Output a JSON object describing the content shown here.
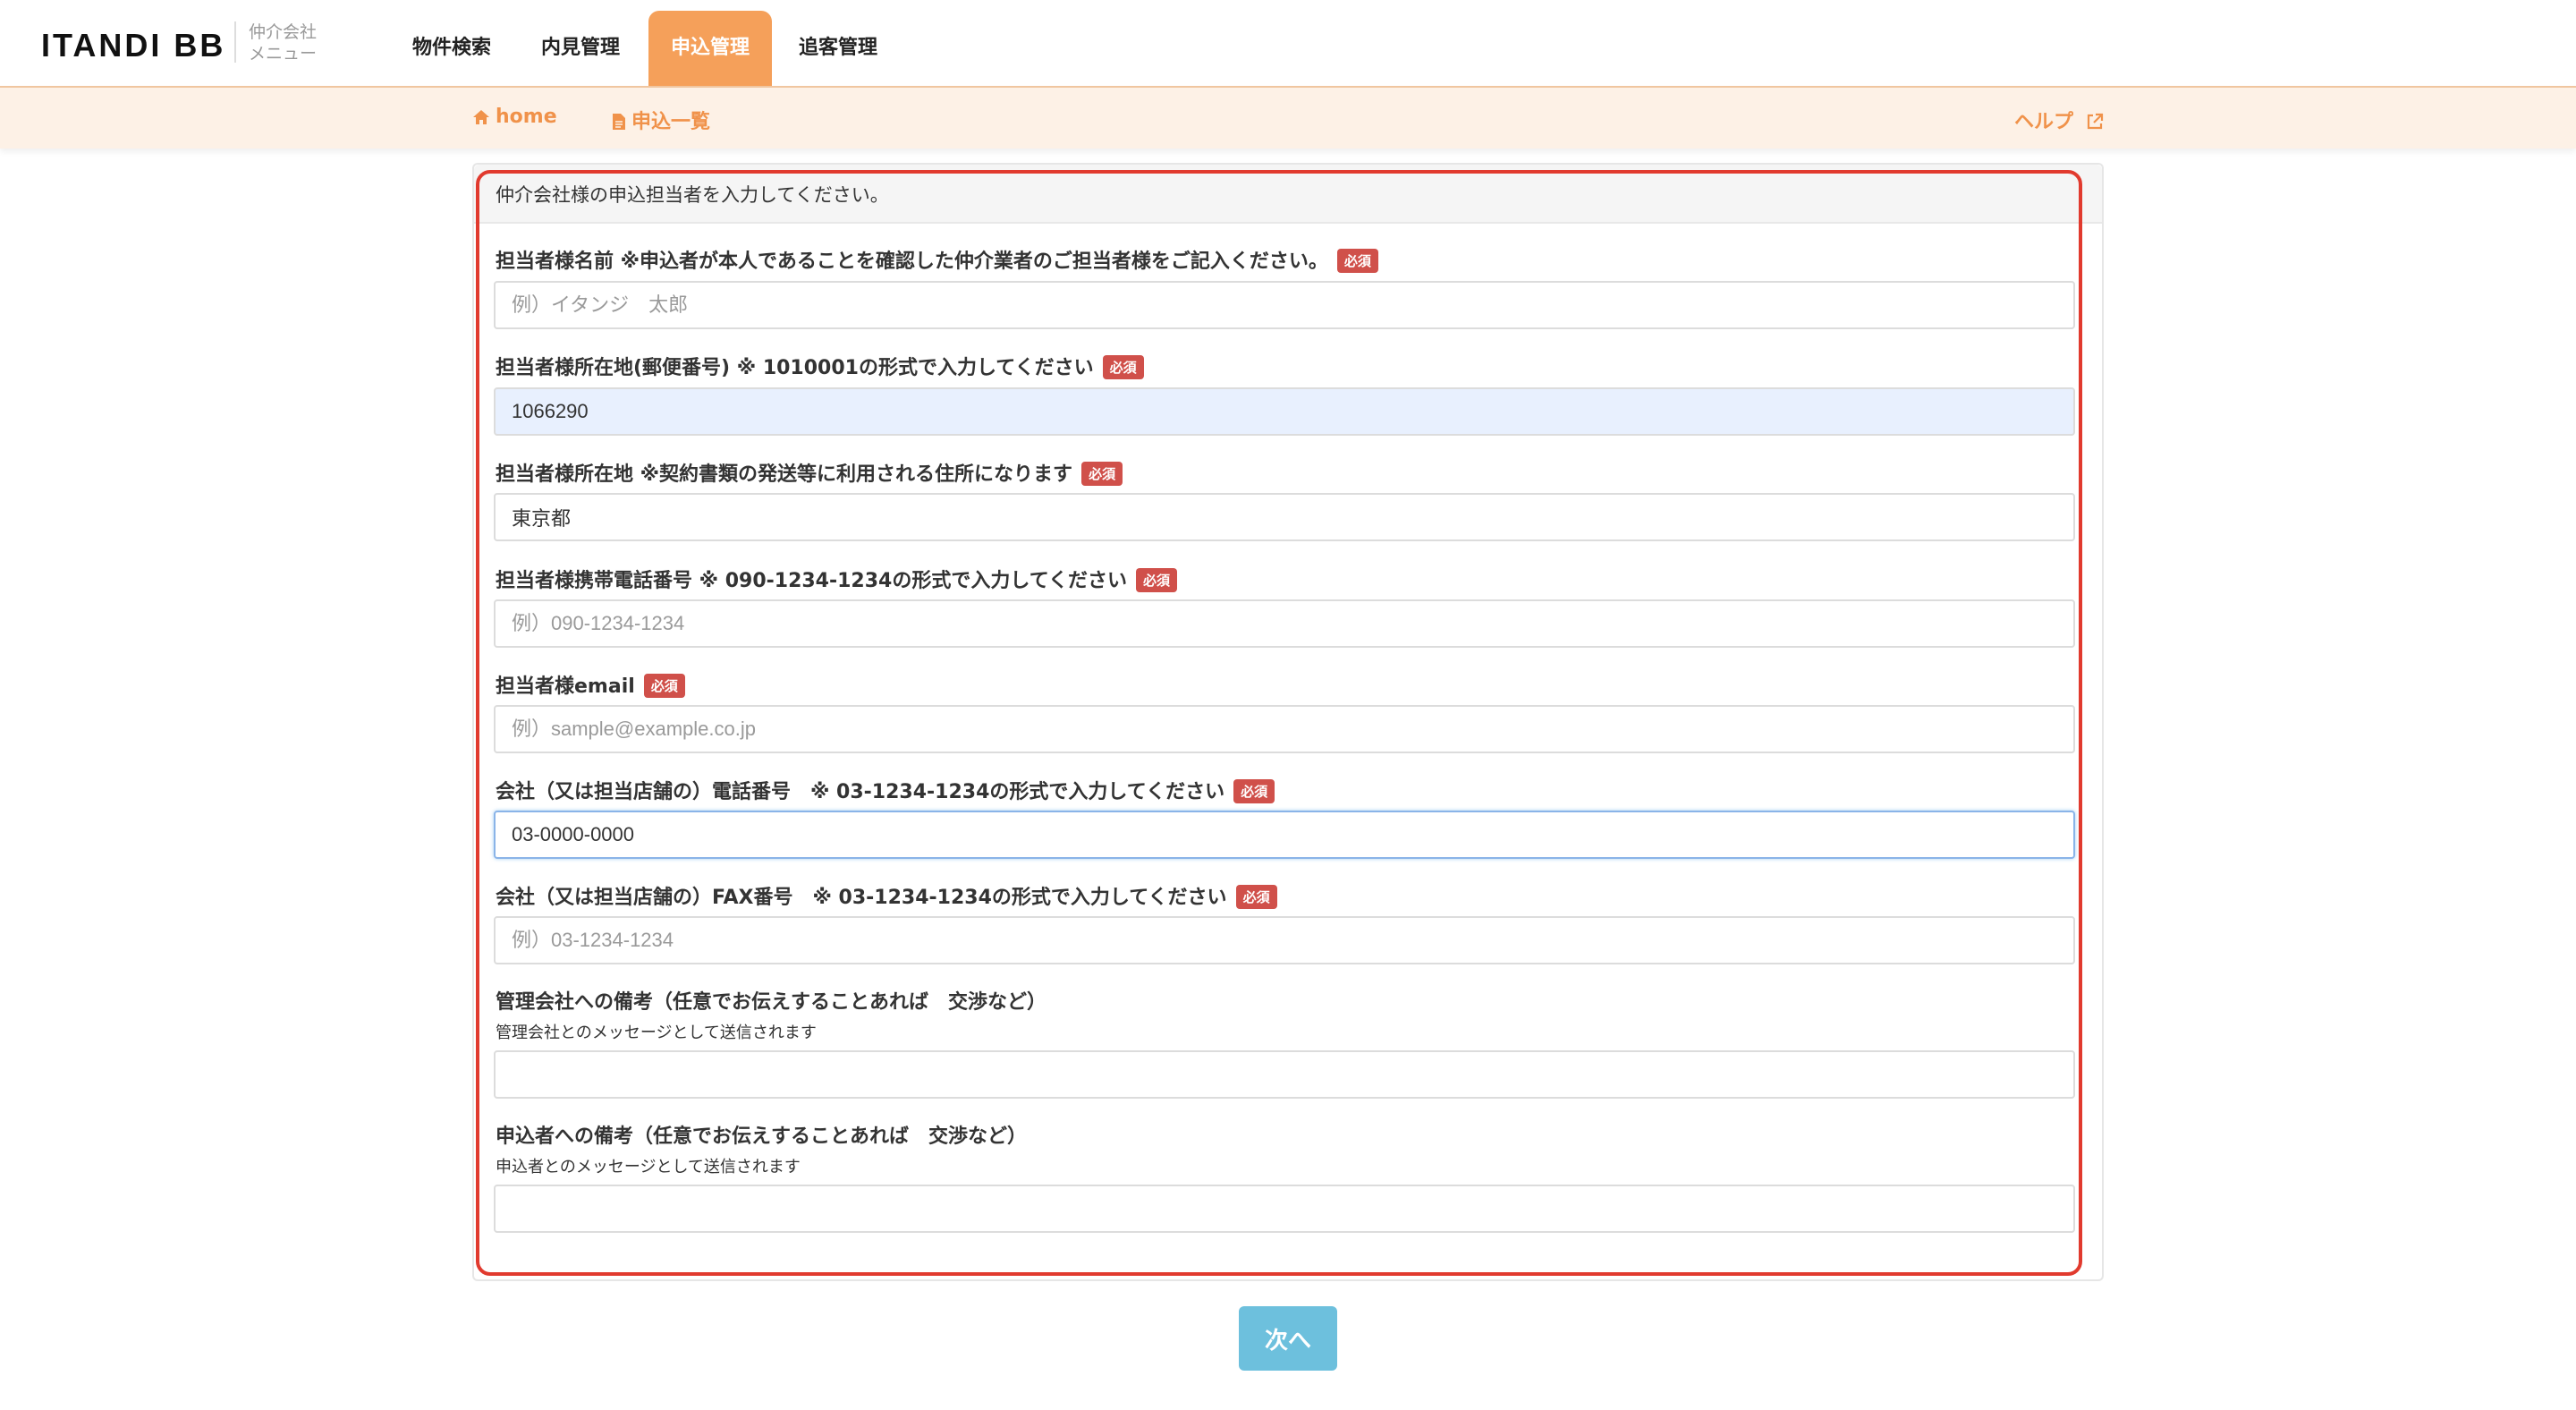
{
  "header": {
    "logo": "ITANDI BB",
    "menu_line1": "仲介会社",
    "menu_line2": "メニュー",
    "tabs": [
      {
        "label": "物件検索"
      },
      {
        "label": "内見管理"
      },
      {
        "label": "申込管理",
        "active": true
      },
      {
        "label": "追客管理"
      }
    ]
  },
  "subnav": {
    "home": "home",
    "list": "申込一覧",
    "help": "ヘルプ"
  },
  "form": {
    "heading": "仲介会社様の申込担当者を入力してください。",
    "required_label": "必須",
    "fields": [
      {
        "label": "担当者様名前 ※申込者が本人であることを確認した仲介業者のご担当者様をご記入ください。",
        "required": true,
        "value": "",
        "placeholder": "例）イタンジ　太郎"
      },
      {
        "label": "担当者様所在地(郵便番号) ※ 1010001の形式で入力してください",
        "required": true,
        "value": "1066290",
        "placeholder": ""
      },
      {
        "label": "担当者様所在地 ※契約書類の発送等に利用される住所になります",
        "required": true,
        "value": "東京都",
        "placeholder": ""
      },
      {
        "label": "担当者様携帯電話番号 ※ 090-1234-1234の形式で入力してください",
        "required": true,
        "value": "",
        "placeholder": "例）090-1234-1234"
      },
      {
        "label": "担当者様email",
        "required": true,
        "value": "",
        "placeholder": "例）sample@example.co.jp"
      },
      {
        "label": "会社（又は担当店舗の）電話番号　※ 03-1234-1234の形式で入力してください",
        "required": true,
        "value": "03-0000-0000",
        "placeholder": ""
      },
      {
        "label": "会社（又は担当店舗の）FAX番号　※ 03-1234-1234の形式で入力してください",
        "required": true,
        "value": "",
        "placeholder": "例）03-1234-1234"
      },
      {
        "label": "管理会社への備考（任意でお伝えすることあれば　交渉など）",
        "help": "管理会社とのメッセージとして送信されます",
        "required": false,
        "value": "",
        "placeholder": ""
      },
      {
        "label": "申込者への備考（任意でお伝えすることあれば　交渉など）",
        "help": "申込者とのメッセージとして送信されます",
        "required": false,
        "value": "",
        "placeholder": ""
      }
    ]
  },
  "actions": {
    "next_label": "次へ"
  },
  "colors": {
    "accent": "#f5a05a",
    "required_badge": "#d0504a",
    "next_button": "#6dc0dd",
    "highlight_border": "#e13a2e"
  }
}
